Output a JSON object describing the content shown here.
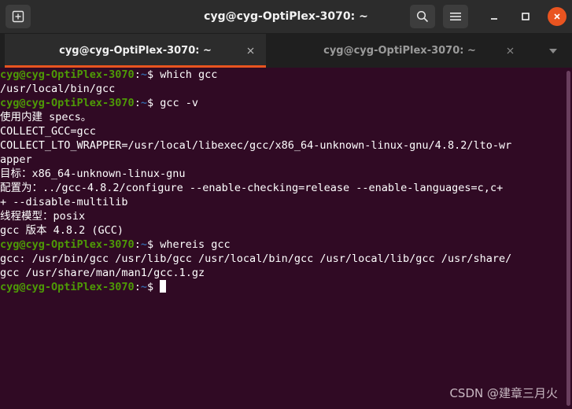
{
  "window": {
    "title": "cyg@cyg-OptiPlex-3070: ~"
  },
  "tabs": [
    {
      "label": "cyg@cyg-OptiPlex-3070: ~",
      "active": true
    },
    {
      "label": "cyg@cyg-OptiPlex-3070: ~",
      "active": false
    }
  ],
  "prompt": {
    "user": "cyg@cyg-OptiPlex-3070",
    "sep": ":",
    "path": "~",
    "symbol": "$ "
  },
  "terminal": {
    "lines": [
      {
        "type": "prompt",
        "cmd": "which gcc"
      },
      {
        "type": "out",
        "text": "/usr/local/bin/gcc"
      },
      {
        "type": "prompt",
        "cmd": "gcc -v"
      },
      {
        "type": "out",
        "text": "使用内建 specs。"
      },
      {
        "type": "out",
        "text": "COLLECT_GCC=gcc"
      },
      {
        "type": "out",
        "text": "COLLECT_LTO_WRAPPER=/usr/local/libexec/gcc/x86_64-unknown-linux-gnu/4.8.2/lto-wr"
      },
      {
        "type": "out",
        "text": "apper"
      },
      {
        "type": "out",
        "text": "目标：x86_64-unknown-linux-gnu"
      },
      {
        "type": "out",
        "text": "配置为：../gcc-4.8.2/configure --enable-checking=release --enable-languages=c,c+"
      },
      {
        "type": "out",
        "text": "+ --disable-multilib"
      },
      {
        "type": "out",
        "text": "线程模型：posix"
      },
      {
        "type": "out",
        "text": "gcc 版本 4.8.2 (GCC)"
      },
      {
        "type": "prompt",
        "cmd": "whereis gcc"
      },
      {
        "type": "out",
        "text": "gcc: /usr/bin/gcc /usr/lib/gcc /usr/local/bin/gcc /usr/local/lib/gcc /usr/share/"
      },
      {
        "type": "out",
        "text": "gcc /usr/share/man/man1/gcc.1.gz"
      },
      {
        "type": "prompt",
        "cmd": "",
        "cursor": true
      }
    ]
  },
  "watermark": "CSDN @建章三月火",
  "colors": {
    "background": "#300a24",
    "prompt_user": "#4e9a06",
    "prompt_path": "#3465a4",
    "accent": "#e95420"
  }
}
